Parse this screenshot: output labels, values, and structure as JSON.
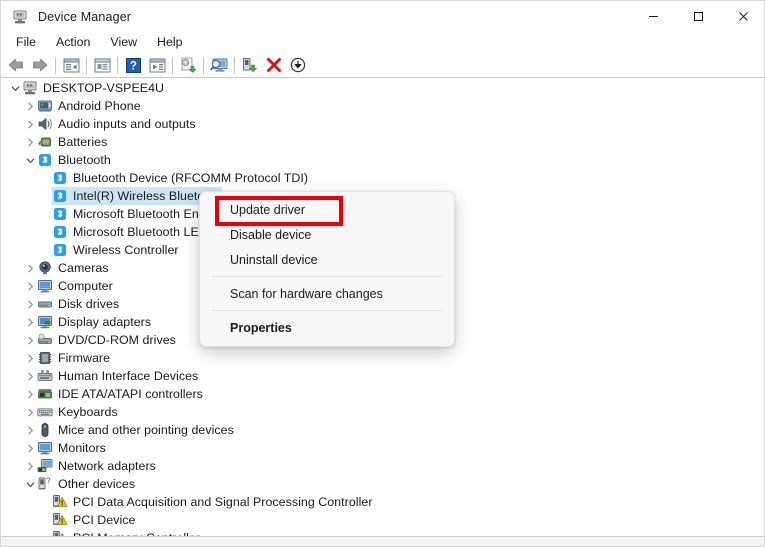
{
  "window": {
    "title": "Device Manager",
    "icon": "device-manager-icon",
    "controls": {
      "minimize": "—",
      "maximize": "□",
      "close": "✕"
    }
  },
  "menubar": {
    "items": [
      {
        "label": "File"
      },
      {
        "label": "Action"
      },
      {
        "label": "View"
      },
      {
        "label": "Help"
      }
    ]
  },
  "toolbar": {
    "buttons": [
      {
        "name": "back-icon",
        "tip": "Back"
      },
      {
        "name": "forward-icon",
        "tip": "Forward"
      },
      {
        "name": "show-hide-console-tree-icon",
        "tip": "Show/hide console tree"
      },
      {
        "name": "properties-icon",
        "tip": "Properties"
      },
      {
        "name": "help-icon",
        "tip": "Help"
      },
      {
        "name": "view-icon",
        "tip": "View"
      },
      {
        "name": "update-driver-icon",
        "tip": "Update driver"
      },
      {
        "name": "scan-for-hardware-changes-icon",
        "tip": "Scan for hardware changes"
      },
      {
        "name": "enable-device-icon",
        "tip": "Enable device"
      },
      {
        "name": "uninstall-device-icon",
        "tip": "Uninstall device"
      },
      {
        "name": "disable-device-icon",
        "tip": "Disable device"
      }
    ]
  },
  "tree": {
    "nodes": [
      {
        "label": "DESKTOP-VSPEE4U",
        "depth": 0,
        "chevron": "down",
        "icon": "computer-icon",
        "selected": false
      },
      {
        "label": "Android Phone",
        "depth": 1,
        "chevron": "right",
        "icon": "android-phone-icon",
        "selected": false
      },
      {
        "label": "Audio inputs and outputs",
        "depth": 1,
        "chevron": "right",
        "icon": "speaker-icon",
        "selected": false
      },
      {
        "label": "Batteries",
        "depth": 1,
        "chevron": "right",
        "icon": "battery-icon",
        "selected": false
      },
      {
        "label": "Bluetooth",
        "depth": 1,
        "chevron": "down",
        "icon": "bluetooth-icon",
        "selected": false
      },
      {
        "label": "Bluetooth Device (RFCOMM Protocol TDI)",
        "depth": 2,
        "chevron": "none",
        "icon": "bluetooth-icon",
        "selected": false
      },
      {
        "label": "Intel(R) Wireless Bluetooth(R)",
        "depth": 2,
        "chevron": "none",
        "icon": "bluetooth-icon",
        "selected": true
      },
      {
        "label": "Microsoft Bluetooth Enumerator",
        "depth": 2,
        "chevron": "none",
        "icon": "bluetooth-icon",
        "selected": false
      },
      {
        "label": "Microsoft Bluetooth LE Enumerator",
        "depth": 2,
        "chevron": "none",
        "icon": "bluetooth-icon",
        "selected": false
      },
      {
        "label": "Wireless Controller",
        "depth": 2,
        "chevron": "none",
        "icon": "bluetooth-icon",
        "selected": false
      },
      {
        "label": "Cameras",
        "depth": 1,
        "chevron": "right",
        "icon": "camera-icon",
        "selected": false
      },
      {
        "label": "Computer",
        "depth": 1,
        "chevron": "right",
        "icon": "monitor-icon",
        "selected": false
      },
      {
        "label": "Disk drives",
        "depth": 1,
        "chevron": "right",
        "icon": "disk-drive-icon",
        "selected": false
      },
      {
        "label": "Display adapters",
        "depth": 1,
        "chevron": "right",
        "icon": "display-adapter-icon",
        "selected": false
      },
      {
        "label": "DVD/CD-ROM drives",
        "depth": 1,
        "chevron": "right",
        "icon": "dvd-drive-icon",
        "selected": false
      },
      {
        "label": "Firmware",
        "depth": 1,
        "chevron": "right",
        "icon": "firmware-chip-icon",
        "selected": false
      },
      {
        "label": "Human Interface Devices",
        "depth": 1,
        "chevron": "right",
        "icon": "hid-icon",
        "selected": false
      },
      {
        "label": "IDE ATA/ATAPI controllers",
        "depth": 1,
        "chevron": "right",
        "icon": "ide-controller-icon",
        "selected": false
      },
      {
        "label": "Keyboards",
        "depth": 1,
        "chevron": "right",
        "icon": "keyboard-icon",
        "selected": false
      },
      {
        "label": "Mice and other pointing devices",
        "depth": 1,
        "chevron": "right",
        "icon": "mouse-icon",
        "selected": false
      },
      {
        "label": "Monitors",
        "depth": 1,
        "chevron": "right",
        "icon": "monitor-icon",
        "selected": false
      },
      {
        "label": "Network adapters",
        "depth": 1,
        "chevron": "right",
        "icon": "network-adapter-icon",
        "selected": false
      },
      {
        "label": "Other devices",
        "depth": 1,
        "chevron": "down",
        "icon": "unknown-device-icon",
        "selected": false
      },
      {
        "label": "PCI Data Acquisition and Signal Processing Controller",
        "depth": 2,
        "chevron": "none",
        "icon": "unknown-device-warning-icon",
        "selected": false
      },
      {
        "label": "PCI Device",
        "depth": 2,
        "chevron": "none",
        "icon": "unknown-device-warning-icon",
        "selected": false
      },
      {
        "label": "PCI Memory Controller",
        "depth": 2,
        "chevron": "none",
        "icon": "unknown-device-warning-icon",
        "selected": false
      }
    ]
  },
  "context_menu": {
    "items": [
      {
        "label": "Update driver",
        "bold": false,
        "highlighted": true
      },
      {
        "label": "Disable device",
        "bold": false,
        "highlighted": false
      },
      {
        "label": "Uninstall device",
        "bold": false,
        "highlighted": false
      },
      {
        "separator": true
      },
      {
        "label": "Scan for hardware changes",
        "bold": false,
        "highlighted": false
      },
      {
        "separator": true
      },
      {
        "label": "Properties",
        "bold": true,
        "highlighted": false
      }
    ]
  },
  "annotation": {
    "highlight_color": "#ee0000",
    "target": "Update driver"
  }
}
